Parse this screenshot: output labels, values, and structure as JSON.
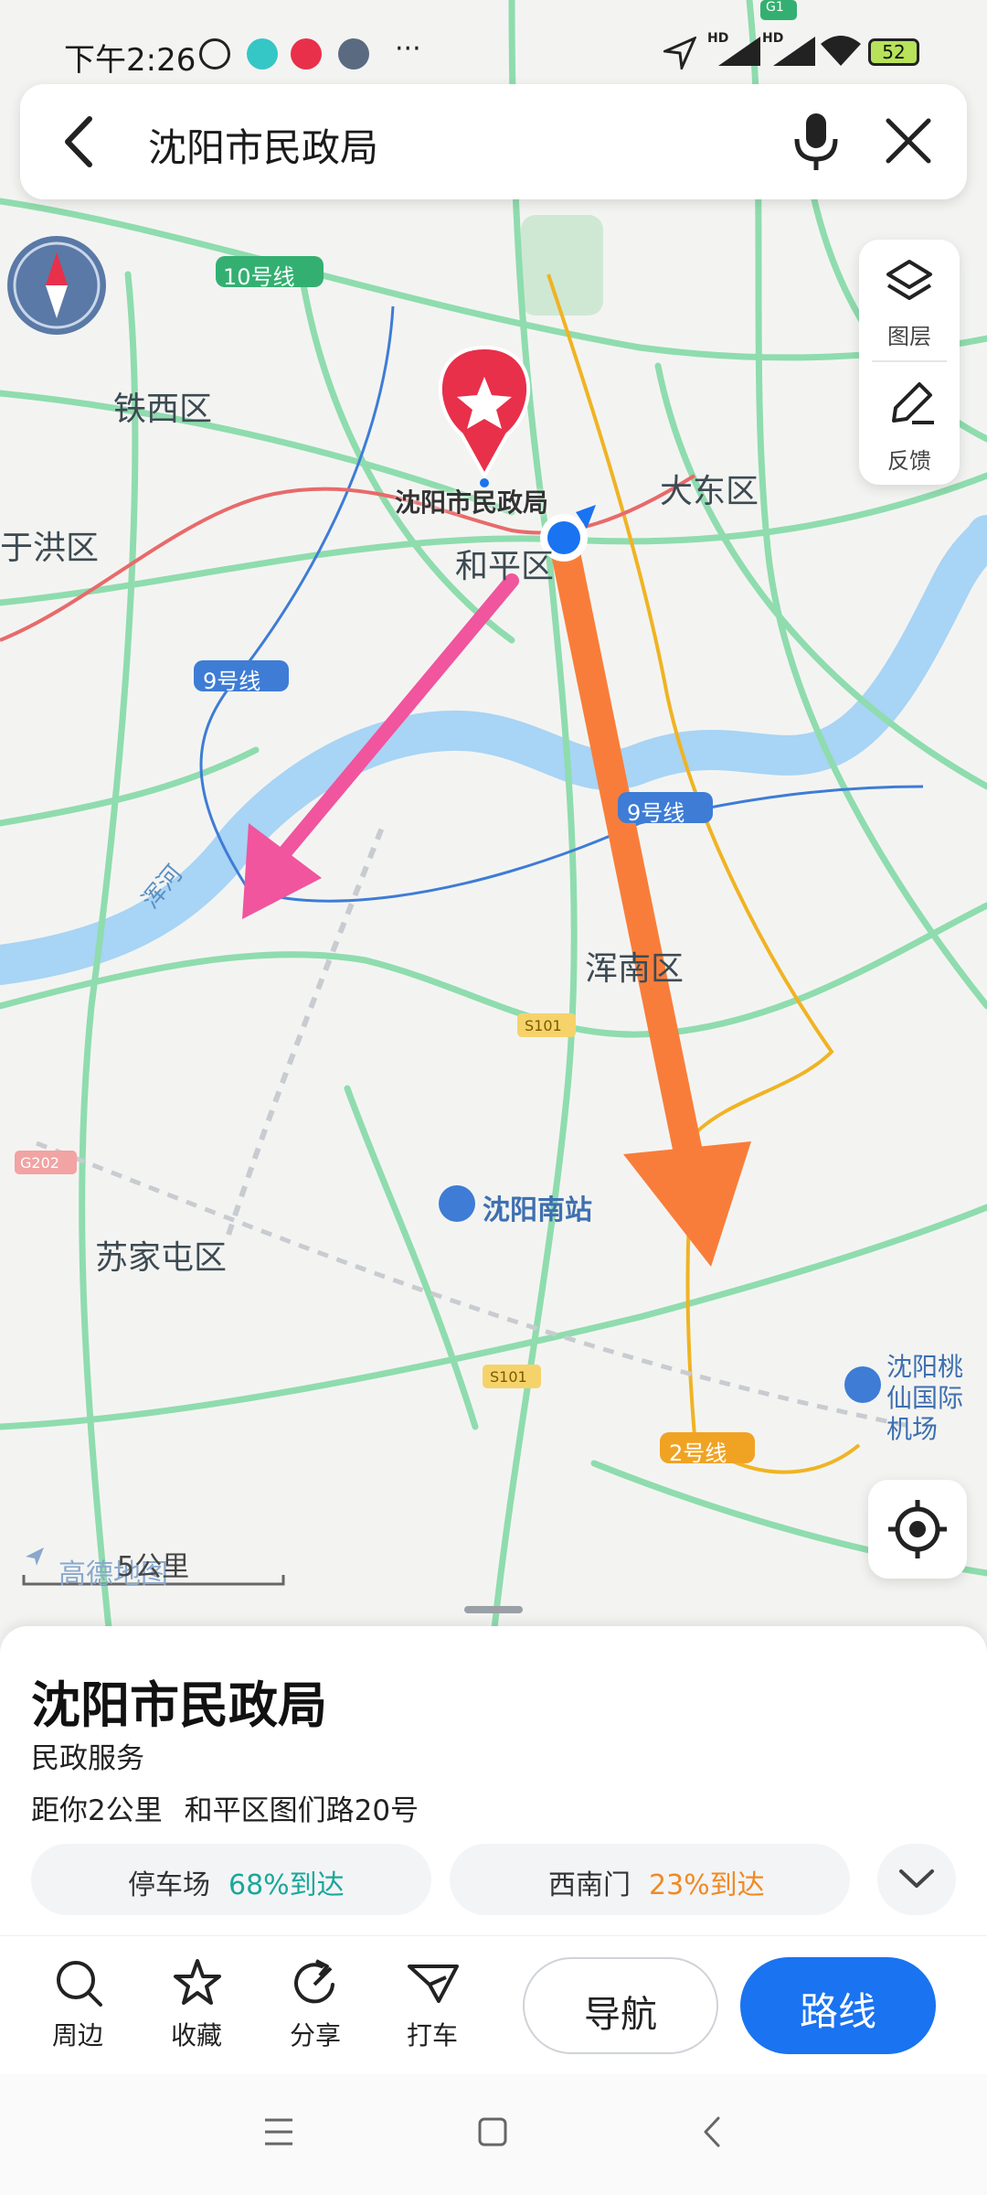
{
  "status_bar": {
    "time": "下午2:26",
    "battery": "52",
    "network_badge_1": "HD",
    "network_badge_2": "HD",
    "more": "···"
  },
  "search": {
    "query": "沈阳市民政局"
  },
  "map_controls": {
    "layers_label": "图层",
    "feedback_label": "反馈"
  },
  "map": {
    "districts": [
      "铁西区",
      "于洪区",
      "和平区",
      "大东区",
      "浑南区",
      "苏家屯区"
    ],
    "metro_lines": [
      "10号线",
      "9号线",
      "9号线",
      "2号线"
    ],
    "roads": [
      "G1",
      "S101",
      "S101",
      "G202"
    ],
    "river": "浑河",
    "poi_marker_label": "沈阳市民政局",
    "station": "沈阳南站",
    "airport": "沈阳桃仙国际机场",
    "brand": "高德地图",
    "scale": "5公里"
  },
  "place": {
    "name": "沈阳市民政局",
    "category": "民政服务",
    "distance": "距你2公里",
    "address": "和平区图们路20号"
  },
  "chips": [
    {
      "label": "停车场",
      "stat": "68%到达",
      "color": "#19a89a"
    },
    {
      "label": "西南门",
      "stat": "23%到达",
      "color": "#f08a24"
    }
  ],
  "actions": [
    {
      "label": "周边",
      "icon": "search-icon"
    },
    {
      "label": "收藏",
      "icon": "star-icon"
    },
    {
      "label": "分享",
      "icon": "share-icon"
    },
    {
      "label": "打车",
      "icon": "taxi-icon"
    }
  ],
  "buttons": {
    "navigate": "导航",
    "route": "路线"
  },
  "colors": {
    "accent_blue": "#1a73f0",
    "marker_red": "#e8304a",
    "annotation_pink": "#f0559e",
    "annotation_orange": "#f97d3a",
    "road_green": "#8fdcae",
    "water": "#a8d4f5"
  }
}
